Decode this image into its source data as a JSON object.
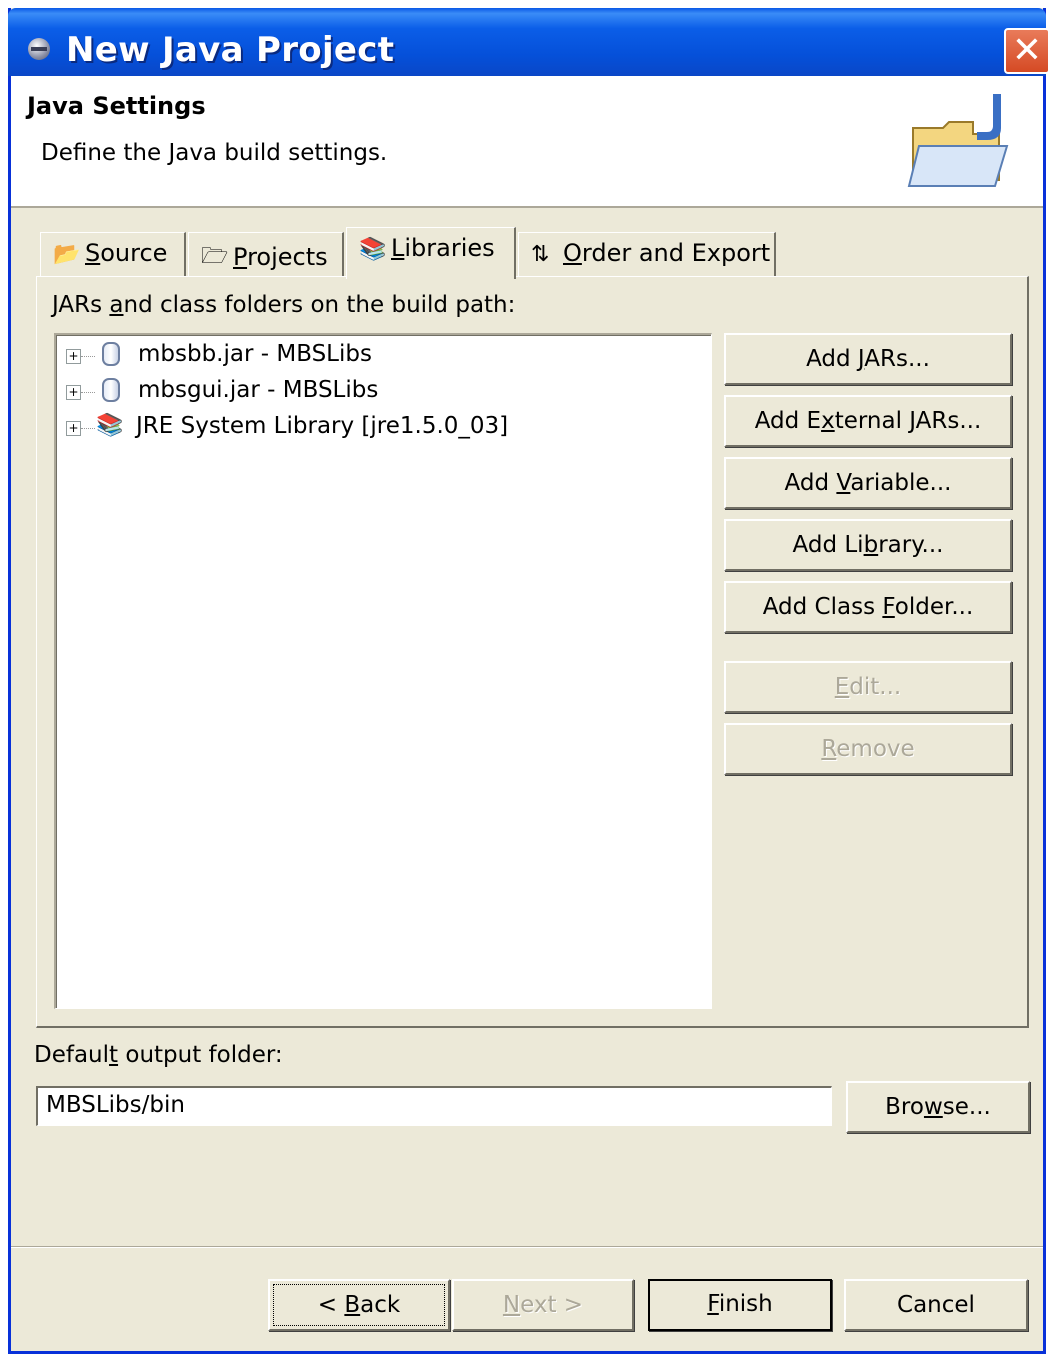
{
  "window": {
    "title": "New Java Project"
  },
  "header": {
    "title": "Java Settings",
    "description": "Define the Java build settings."
  },
  "tabs": [
    {
      "label": "Source",
      "mnemonic_prefix": "",
      "mnemonic": "S",
      "rest": "ource",
      "icon": "source-folder-icon"
    },
    {
      "label": "Projects",
      "mnemonic_prefix": "",
      "mnemonic": "P",
      "rest": "rojects",
      "icon": "projects-folder-icon"
    },
    {
      "label": "Libraries",
      "mnemonic_prefix": "",
      "mnemonic": "L",
      "rest": "ibraries",
      "icon": "libraries-icon",
      "active": true
    },
    {
      "label": "Order and Export",
      "mnemonic_prefix": "",
      "mnemonic": "O",
      "rest": "rder and Export",
      "icon": "order-export-icon"
    }
  ],
  "libraries": {
    "list_label_pre": "JARs ",
    "list_label_mnemonic": "a",
    "list_label_post": "nd class folders on the build path:",
    "entries": [
      {
        "text": "mbsbb.jar - MBSLibs",
        "icon": "jar-icon"
      },
      {
        "text": "mbsgui.jar - MBSLibs",
        "icon": "jar-icon"
      },
      {
        "text": "JRE System Library [jre1.5.0_03]",
        "icon": "library-icon"
      }
    ],
    "buttons": {
      "add_jars": {
        "pre": "Add ",
        "m": "J",
        "post": "ARs..."
      },
      "add_external_jars": {
        "pre": "Add E",
        "m": "x",
        "post": "ternal JARs..."
      },
      "add_variable": {
        "pre": "Add ",
        "m": "V",
        "post": "ariable..."
      },
      "add_library": {
        "pre": "Add Li",
        "m": "b",
        "post": "rary..."
      },
      "add_class_folder": {
        "pre": "Add Class ",
        "m": "F",
        "post": "older..."
      },
      "edit": {
        "pre": "",
        "m": "E",
        "post": "dit..."
      },
      "remove": {
        "pre": "",
        "m": "R",
        "post": "emove"
      }
    }
  },
  "output": {
    "label_pre": "Defaul",
    "label_m": "t",
    "label_post": " output folder:",
    "value": "MBSLibs/bin",
    "browse": {
      "pre": "Bro",
      "m": "w",
      "post": "se..."
    }
  },
  "footer": {
    "back": {
      "pre": "< ",
      "m": "B",
      "post": "ack"
    },
    "next": {
      "pre": "",
      "m": "N",
      "post": "ext >"
    },
    "finish": {
      "pre": "",
      "m": "F",
      "post": "inish"
    },
    "cancel": "Cancel"
  },
  "colors": {
    "titlebar": "#0550d9",
    "dialog_bg": "#ece9d8",
    "close": "#d54a24",
    "disabled_text": "#aca899"
  }
}
